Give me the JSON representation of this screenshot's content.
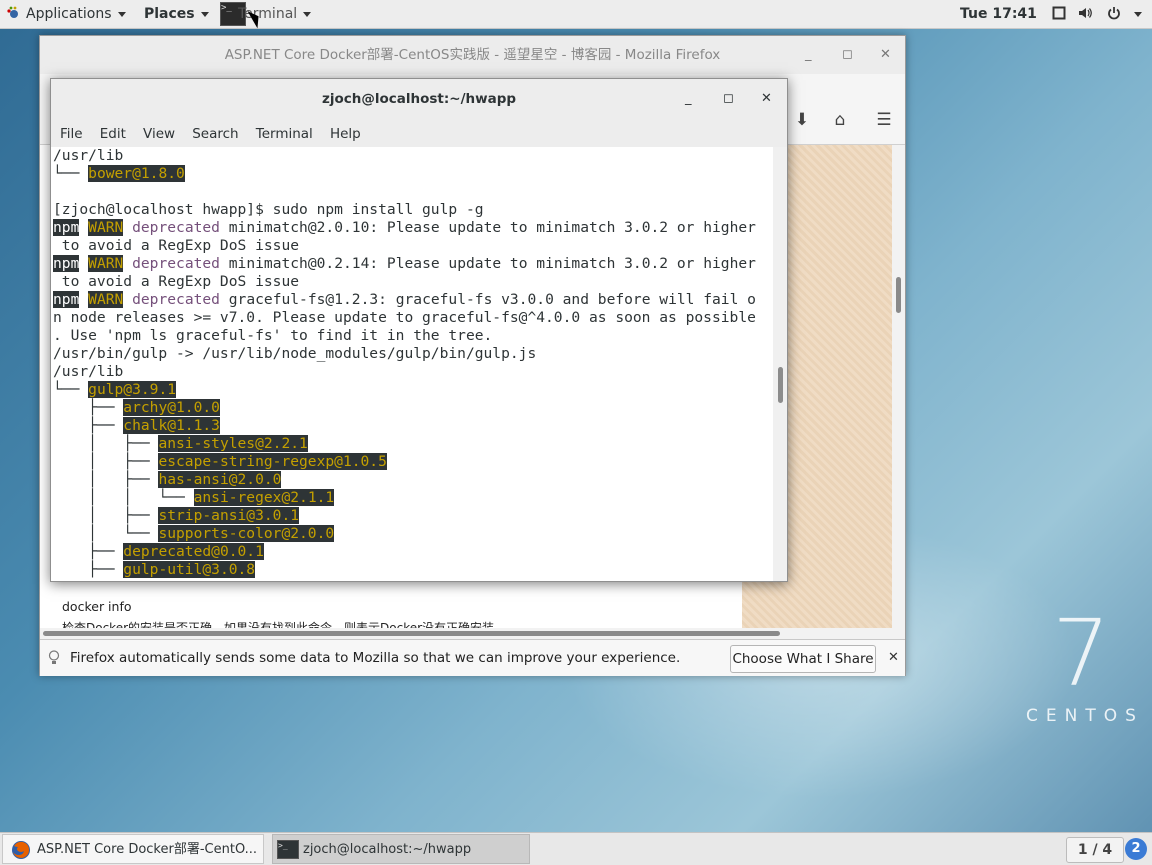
{
  "topbar": {
    "applications": "Applications",
    "places": "Places",
    "terminal": "Terminal",
    "clock": "Tue 17:41",
    "icons": [
      "window-icon",
      "volume-icon",
      "power-icon"
    ]
  },
  "desktop": {
    "logo_number": "7",
    "logo_word": "CENTOS"
  },
  "firefox": {
    "title": "ASP.NET Core Docker部署-CentOS实践版 - 遥望星空 - 博客园 - Mozilla Firefox",
    "page_line1": "docker info",
    "page_line2": "检查Docker的安装是否正确，如果没有找到此命令，则表示Docker没有正确安装",
    "notification": {
      "text": "Firefox automatically sends some data to Mozilla so that we can improve your experience.",
      "button": "Choose What I Share"
    }
  },
  "terminal": {
    "title": "zjoch@localhost:~/hwapp",
    "menu": [
      "File",
      "Edit",
      "View",
      "Search",
      "Terminal",
      "Help"
    ],
    "lines": {
      "l1": "/usr/lib",
      "l2_tree": "└── ",
      "l2_pkg": "bower@1.8.0",
      "l4": "[zjoch@localhost hwapp]$ sudo npm install gulp -g",
      "npm": "npm",
      "warn": "WARN",
      "deprecated": "deprecated",
      "l5_rest": " minimatch@2.0.10: Please update to minimatch 3.0.2 or higher",
      "l6": " to avoid a RegExp DoS issue",
      "l7_rest": " minimatch@0.2.14: Please update to minimatch 3.0.2 or higher",
      "l8": " to avoid a RegExp DoS issue",
      "l9_rest": " graceful-fs@1.2.3: graceful-fs v3.0.0 and before will fail o",
      "l10": "n node releases >= v7.0. Please update to graceful-fs@^4.0.0 as soon as possible",
      "l11": ". Use 'npm ls graceful-fs' to find it in the tree.",
      "l12": "/usr/bin/gulp -> /usr/lib/node_modules/gulp/bin/gulp.js",
      "l13": "/usr/lib"
    },
    "tree": [
      {
        "prefix": "└── ",
        "pkg": "gulp@3.9.1"
      },
      {
        "prefix": "    ├── ",
        "pkg": "archy@1.0.0"
      },
      {
        "prefix": "    ├── ",
        "pkg": "chalk@1.1.3"
      },
      {
        "prefix": "    │   ├── ",
        "pkg": "ansi-styles@2.2.1"
      },
      {
        "prefix": "    │   ├── ",
        "pkg": "escape-string-regexp@1.0.5"
      },
      {
        "prefix": "    │   ├── ",
        "pkg": "has-ansi@2.0.0"
      },
      {
        "prefix": "    │   │   └── ",
        "pkg": "ansi-regex@2.1.1"
      },
      {
        "prefix": "    │   ├── ",
        "pkg": "strip-ansi@3.0.1"
      },
      {
        "prefix": "    │   └── ",
        "pkg": "supports-color@2.0.0"
      },
      {
        "prefix": "    ├── ",
        "pkg": "deprecated@0.0.1"
      },
      {
        "prefix": "    ├── ",
        "pkg": "gulp-util@3.0.8"
      }
    ]
  },
  "taskbar": {
    "firefox_task": "ASP.NET Core Docker部署-CentO...",
    "terminal_task": "zjoch@localhost:~/hwapp",
    "workspace": "1 / 4",
    "notification_count": "2"
  }
}
